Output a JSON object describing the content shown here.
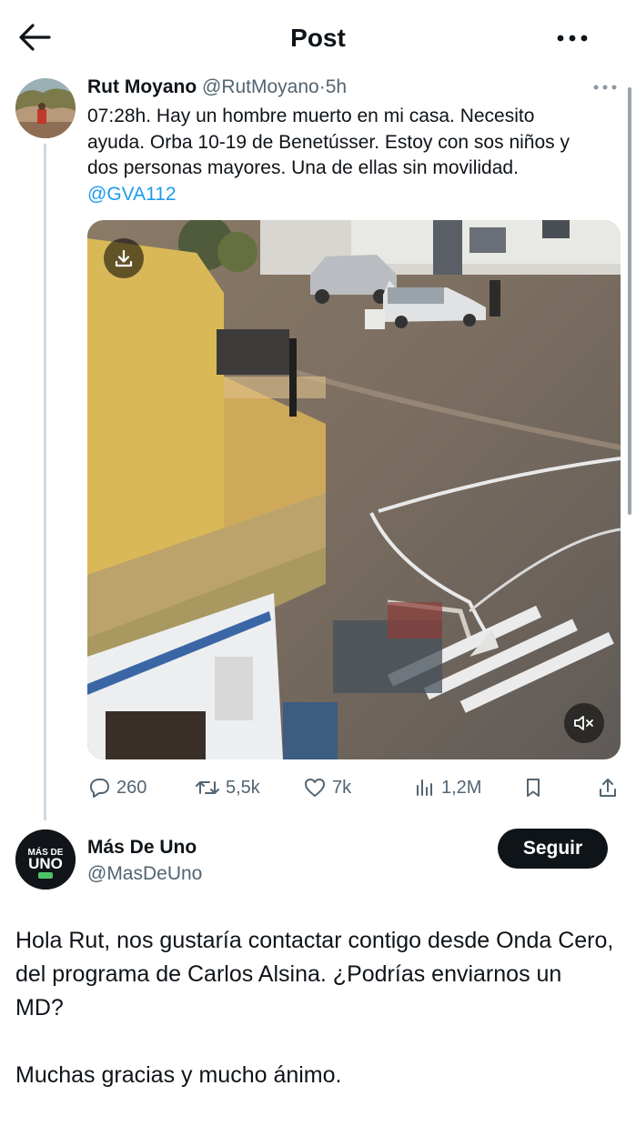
{
  "header": {
    "title": "Post"
  },
  "tweet": {
    "author_name": "Rut Moyano",
    "author_handle": "@RutMoyano",
    "separator": "·",
    "time": "5h",
    "text_lines": [
      "07:28h. Hay un hombre muerto en mi casa. Necesito",
      "ayuda. Orba 10-19 de Benetússer. Estoy con sos niños y",
      "dos personas mayores. Una de ellas sin movilidad."
    ],
    "mention": "@GVA112",
    "stats": {
      "replies": "260",
      "reposts": "5,5k",
      "likes": "7k",
      "views": "1,2M"
    }
  },
  "reply": {
    "author_name": "Más De Uno",
    "author_handle": "@MasDeUno",
    "avatar_text_top": "MÁS DE",
    "avatar_text_bottom": "UNO",
    "follow_label": "Seguir",
    "paragraphs": [
      "Hola Rut, nos gustaría contactar contigo desde Onda Cero, del programa de Carlos Alsina. ¿Podrías enviarnos un MD?",
      "Muchas gracias y mucho ánimo."
    ]
  },
  "icons": {
    "back": "arrow-left-icon",
    "more": "ellipsis-icon",
    "download": "download-icon",
    "mute": "speaker-muted-icon",
    "reply": "comment-icon",
    "repost": "repost-icon",
    "like": "heart-icon",
    "views": "bar-chart-icon",
    "bookmark": "bookmark-icon",
    "share": "share-icon"
  },
  "colors": {
    "link": "#1d9bf0",
    "text": "#0f1419",
    "secondary": "#536471",
    "button": "#0f1419"
  }
}
